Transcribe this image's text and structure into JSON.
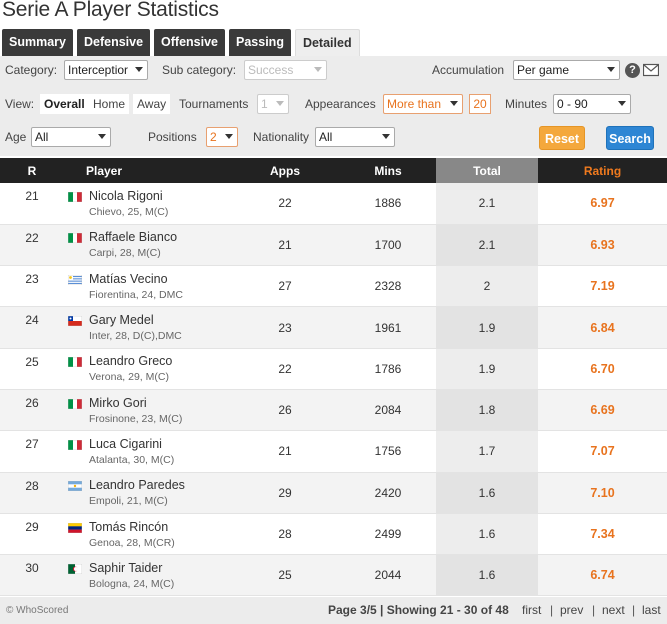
{
  "page": {
    "title": "Serie A Player Statistics"
  },
  "tabs": [
    {
      "label": "Summary"
    },
    {
      "label": "Defensive"
    },
    {
      "label": "Offensive"
    },
    {
      "label": "Passing"
    },
    {
      "label": "Detailed"
    }
  ],
  "filters": {
    "category_label": "Category:",
    "category_value": "Interceptior",
    "subcategory_label": "Sub category:",
    "subcategory_value": "Success",
    "accumulation_label": "Accumulation",
    "accumulation_value": "Per game",
    "view_label": "View:",
    "view_options": [
      "Overall",
      "Home",
      "Away"
    ],
    "tournaments_label": "Tournaments",
    "tournaments_value": "1",
    "appearances_label": "Appearances",
    "appearances_value": "More than",
    "appearances_count": "20",
    "minutes_label": "Minutes",
    "minutes_value": "0 - 90",
    "age_label": "Age",
    "age_value": "All",
    "positions_label": "Positions",
    "positions_value": "2",
    "nationality_label": "Nationality",
    "nationality_value": "All",
    "reset_label": "Reset",
    "search_label": "Search",
    "help_glyph": "?"
  },
  "table": {
    "headers": [
      "R",
      "Player",
      "Apps",
      "Mins",
      "Total",
      "Rating"
    ],
    "rows": [
      {
        "rank": "21",
        "name": "Nicola Rigoni",
        "meta": "Chievo, 25, M(C)",
        "flag": "italy",
        "apps": "22",
        "mins": "1886",
        "total": "2.1",
        "rating": "6.97"
      },
      {
        "rank": "22",
        "name": "Raffaele Bianco",
        "meta": "Carpi, 28, M(C)",
        "flag": "italy",
        "apps": "21",
        "mins": "1700",
        "total": "2.1",
        "rating": "6.93"
      },
      {
        "rank": "23",
        "name": "Matías Vecino",
        "meta": "Fiorentina, 24, DMC",
        "flag": "uruguay",
        "apps": "27",
        "mins": "2328",
        "total": "2",
        "rating": "7.19"
      },
      {
        "rank": "24",
        "name": "Gary Medel",
        "meta": "Inter, 28, D(C),DMC",
        "flag": "chile",
        "apps": "23",
        "mins": "1961",
        "total": "1.9",
        "rating": "6.84"
      },
      {
        "rank": "25",
        "name": "Leandro Greco",
        "meta": "Verona, 29, M(C)",
        "flag": "italy",
        "apps": "22",
        "mins": "1786",
        "total": "1.9",
        "rating": "6.70"
      },
      {
        "rank": "26",
        "name": "Mirko Gori",
        "meta": "Frosinone, 23, M(C)",
        "flag": "italy",
        "apps": "26",
        "mins": "2084",
        "total": "1.8",
        "rating": "6.69"
      },
      {
        "rank": "27",
        "name": "Luca Cigarini",
        "meta": "Atalanta, 30, M(C)",
        "flag": "italy",
        "apps": "21",
        "mins": "1756",
        "total": "1.7",
        "rating": "7.07"
      },
      {
        "rank": "28",
        "name": "Leandro Paredes",
        "meta": "Empoli, 21, M(C)",
        "flag": "argentina",
        "apps": "29",
        "mins": "2420",
        "total": "1.6",
        "rating": "7.10"
      },
      {
        "rank": "29",
        "name": "Tomás Rincón",
        "meta": "Genoa, 28, M(CR)",
        "flag": "venezuela",
        "apps": "28",
        "mins": "2499",
        "total": "1.6",
        "rating": "7.34"
      },
      {
        "rank": "30",
        "name": "Saphir Taider",
        "meta": "Bologna, 24, M(C)",
        "flag": "algeria",
        "apps": "25",
        "mins": "2044",
        "total": "1.6",
        "rating": "6.74"
      }
    ]
  },
  "footer": {
    "copyright": "© WhoScored",
    "page_info": "Page 3/5 | Showing 21 - 30 of 48",
    "links": [
      "first",
      "prev",
      "next",
      "last"
    ],
    "separator": "|"
  }
}
